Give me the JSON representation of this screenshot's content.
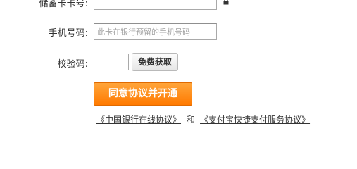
{
  "form": {
    "card_number": {
      "label": "储蓄卡卡号:",
      "value": ""
    },
    "phone": {
      "label": "手机号码:",
      "placeholder": "此卡在银行预留的手机号码"
    },
    "code": {
      "label": "校验码:",
      "value": ""
    },
    "sms_button_label": "免费获取",
    "submit_label": "同意协议并开通"
  },
  "agreements": {
    "bank_link": "《中国银行在线协议》",
    "and_text": "和",
    "alipay_link": "《支付宝快捷支付服务协议》"
  },
  "icons": {
    "lock": "lock-icon"
  },
  "colors": {
    "submit_bg": "#ff8c1a",
    "submit_border": "#e06a00"
  }
}
